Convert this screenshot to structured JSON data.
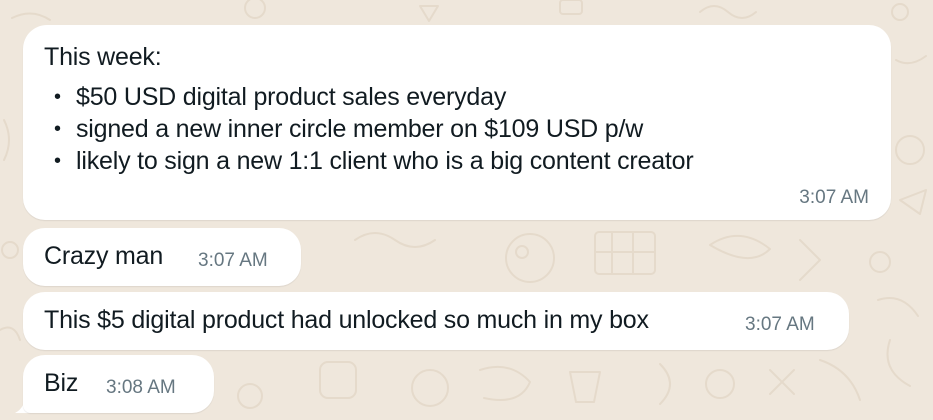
{
  "theme": {
    "background": "#efe7dc",
    "bubble": "#ffffff",
    "text": "#111b21",
    "timestamp": "#667781"
  },
  "messages": [
    {
      "heading": "This week:",
      "items": [
        "$50 USD digital product sales everyday",
        "signed a new inner circle member on $109 USD p/w",
        "likely to sign a new 1:1 client who is a big content creator"
      ],
      "time": "3:07 AM"
    },
    {
      "text": "Crazy man",
      "time": "3:07 AM"
    },
    {
      "text": "This $5 digital product had unlocked so much in my box",
      "time": "3:07 AM"
    },
    {
      "text": "Biz",
      "time": "3:08 AM"
    }
  ]
}
